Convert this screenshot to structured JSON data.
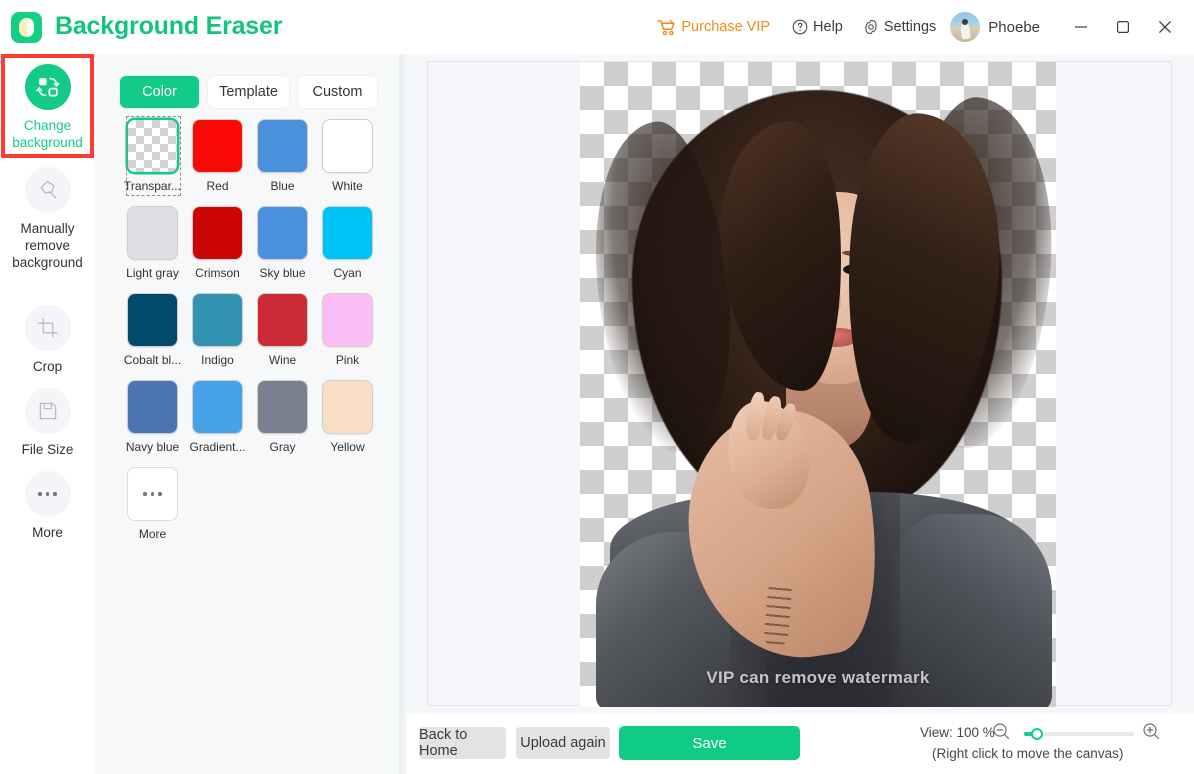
{
  "app": {
    "title": "Background Eraser",
    "logo_color": "#11cf83",
    "accent": "#12cb88"
  },
  "header": {
    "purchase_vip": "Purchase VIP",
    "vip_color": "#f08a1e",
    "help": "Help",
    "settings": "Settings",
    "user_name": "Phoebe",
    "window_controls": [
      "minimize",
      "maximize",
      "close"
    ]
  },
  "sidebar": {
    "highlight_color": "#fe3b30",
    "items": [
      {
        "label": "Change\nbackground",
        "label_line1": "Change",
        "label_line2": "background",
        "icon": "change-background-icon",
        "active": true,
        "highlighted": true
      },
      {
        "label": "Manually remove background",
        "label_line1": "Manually",
        "label_line2": "remove",
        "label_line3": "background",
        "icon": "lasso-icon",
        "active": false,
        "highlighted": false
      },
      {
        "label": "Crop",
        "label_line1": "Crop",
        "icon": "crop-icon",
        "active": false,
        "highlighted": false
      },
      {
        "label": "File Size",
        "label_line1": "File Size",
        "icon": "save-disk-icon",
        "active": false,
        "highlighted": false
      },
      {
        "label": "More",
        "label_line1": "More",
        "icon": "ellipsis-icon",
        "active": false,
        "highlighted": false
      }
    ]
  },
  "panel": {
    "tabs": [
      {
        "label": "Color",
        "selected": true
      },
      {
        "label": "Template",
        "selected": false
      },
      {
        "label": "Custom",
        "selected": false
      }
    ],
    "swatches": [
      {
        "label": "Transpar...",
        "color": "transparent",
        "selected": true,
        "kind": "checker"
      },
      {
        "label": "Red",
        "color": "#fa0a04",
        "selected": false,
        "kind": "solid"
      },
      {
        "label": "Blue",
        "color": "#4a90da",
        "selected": false,
        "kind": "solid"
      },
      {
        "label": "White",
        "color": "#ffffff",
        "selected": false,
        "kind": "solid"
      },
      {
        "label": "Light gray",
        "color": "#e0dee4",
        "selected": false,
        "kind": "solid"
      },
      {
        "label": "Crimson",
        "color": "#cc0505",
        "selected": false,
        "kind": "solid"
      },
      {
        "label": "Sky blue",
        "color": "#4a90de",
        "selected": false,
        "kind": "solid"
      },
      {
        "label": "Cyan",
        "color": "#00c3f5",
        "selected": false,
        "kind": "solid"
      },
      {
        "label": "Cobalt bl...",
        "color": "#024a6b",
        "selected": false,
        "kind": "solid"
      },
      {
        "label": "Indigo",
        "color": "#3392b0",
        "selected": false,
        "kind": "solid"
      },
      {
        "label": "Wine",
        "color": "#cc2a34",
        "selected": false,
        "kind": "solid"
      },
      {
        "label": "Pink",
        "color": "#fcbdf6",
        "selected": false,
        "kind": "solid"
      },
      {
        "label": "Navy blue",
        "color": "#4c74b0",
        "selected": false,
        "kind": "solid"
      },
      {
        "label": "Gradient...",
        "color": "#46a3e8",
        "selected": false,
        "kind": "solid"
      },
      {
        "label": "Gray",
        "color": "#7b8091",
        "selected": false,
        "kind": "solid"
      },
      {
        "label": "Yellow",
        "color": "#f8dfc6",
        "selected": false,
        "kind": "solid"
      },
      {
        "label": "More",
        "color": "#ffffff",
        "selected": false,
        "kind": "more"
      }
    ]
  },
  "canvas": {
    "watermark": "VIP can remove watermark",
    "background": "transparent-checkerboard"
  },
  "bottombar": {
    "back_to_home": "Back to Home",
    "upload_again": "Upload again",
    "save": "Save",
    "view_label": "View: 100 %",
    "zoom_percent": "100",
    "hint": "(Right click to move the canvas)",
    "zoom_out_icon": "zoom-out-icon",
    "zoom_in_icon": "zoom-in-icon"
  }
}
